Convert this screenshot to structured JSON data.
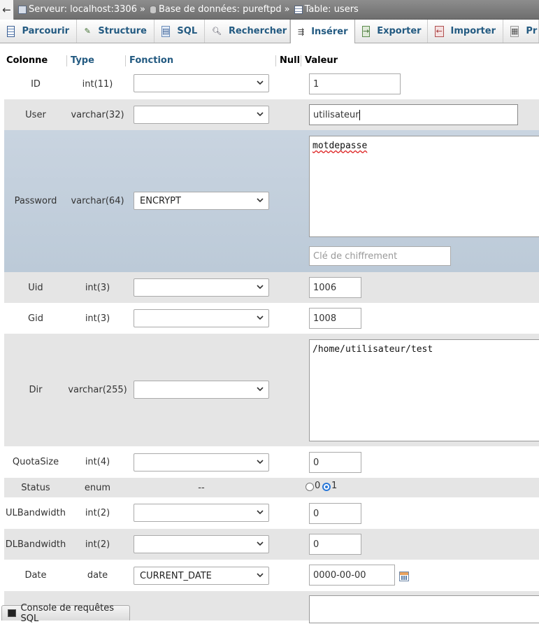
{
  "breadcrumb": {
    "back": "←",
    "server": "Serveur: localhost:3306",
    "database": "Base de données: pureftpd",
    "table": "Table: users",
    "separator": "»"
  },
  "tabs": [
    {
      "label": "Parcourir",
      "icon": "browse-icon"
    },
    {
      "label": "Structure",
      "icon": "structure-icon"
    },
    {
      "label": "SQL",
      "icon": "sql-icon"
    },
    {
      "label": "Rechercher",
      "icon": "search-icon"
    },
    {
      "label": "Insérer",
      "icon": "insert-icon",
      "active": true
    },
    {
      "label": "Exporter",
      "icon": "export-icon"
    },
    {
      "label": "Importer",
      "icon": "import-icon"
    },
    {
      "label": "Pr",
      "icon": "privileges-icon"
    }
  ],
  "headers": {
    "colonne": "Colonne",
    "type": "Type",
    "fonction": "Fonction",
    "null": "Null",
    "valeur": "Valeur"
  },
  "rows": [
    {
      "name": "ID",
      "type": "int(11)",
      "function": "",
      "value": "1"
    },
    {
      "name": "User",
      "type": "varchar(32)",
      "function": "",
      "value": "utilisateur"
    },
    {
      "name": "Password",
      "type": "varchar(64)",
      "function": "ENCRYPT",
      "value": "motdepasse",
      "key_placeholder": "Clé de chiffrement"
    },
    {
      "name": "Uid",
      "type": "int(3)",
      "function": "",
      "value": "1006"
    },
    {
      "name": "Gid",
      "type": "int(3)",
      "function": "",
      "value": "1008"
    },
    {
      "name": "Dir",
      "type": "varchar(255)",
      "function": "",
      "value": "/home/utilisateur/test"
    },
    {
      "name": "QuotaSize",
      "type": "int(4)",
      "function": "",
      "value": "0"
    },
    {
      "name": "Status",
      "type": "enum",
      "function": "--",
      "options": [
        "0",
        "1"
      ],
      "selected": "1"
    },
    {
      "name": "ULBandwidth",
      "type": "int(2)",
      "function": "",
      "value": "0"
    },
    {
      "name": "DLBandwidth",
      "type": "int(2)",
      "function": "",
      "value": "0"
    },
    {
      "name": "Date",
      "type": "date",
      "function": "CURRENT_DATE",
      "value": "0000-00-00"
    }
  ],
  "console": {
    "label": "Console de requêtes SQL"
  },
  "colors": {
    "link": "#235a81",
    "row_grey": "#e5e5e5",
    "row_highlight": "#c3cfdc",
    "radio_accent": "#2a78d8"
  }
}
